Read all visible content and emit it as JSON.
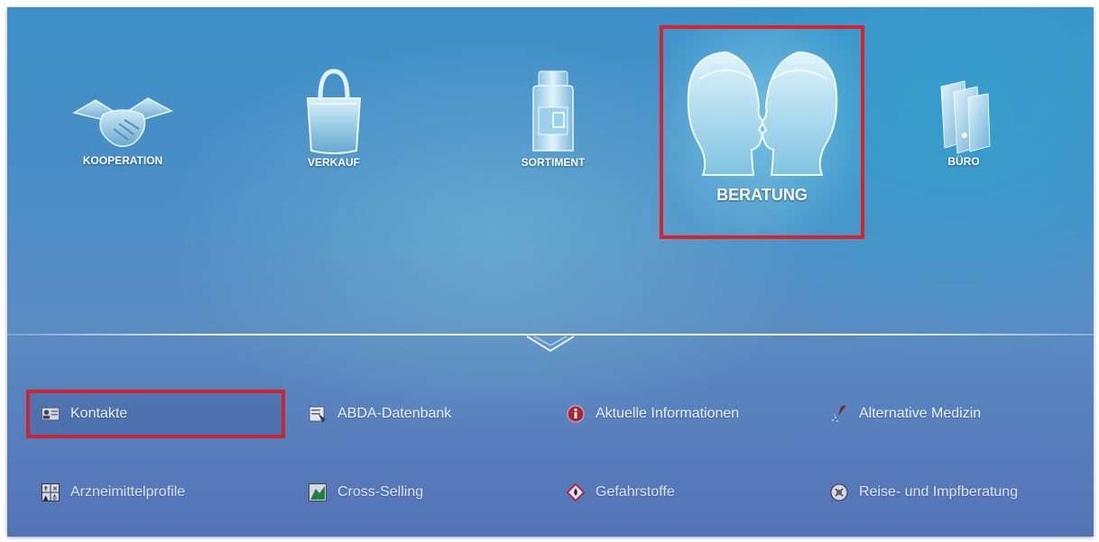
{
  "categories": [
    {
      "key": "kooperation",
      "label": "KOOPERATION"
    },
    {
      "key": "verkauf",
      "label": "VERKAUF"
    },
    {
      "key": "sortiment",
      "label": "SORTIMENT"
    },
    {
      "key": "beratung",
      "label": "BERATUNG"
    },
    {
      "key": "buero",
      "label": "BÜRO"
    }
  ],
  "active_category": "BERATUNG",
  "subitems": [
    {
      "label": "Kontakte",
      "icon": "contact-card-icon"
    },
    {
      "label": "ABDA-Datenbank",
      "icon": "database-icon"
    },
    {
      "label": "Aktuelle Informationen",
      "icon": "info-icon"
    },
    {
      "label": "Alternative Medizin",
      "icon": "mortar-icon"
    },
    {
      "label": "Arzneimittelprofile",
      "icon": "profile-grid-icon"
    },
    {
      "label": "Cross-Selling",
      "icon": "cross-selling-icon"
    },
    {
      "label": "Gefahrstoffe",
      "icon": "hazard-icon"
    },
    {
      "label": "Reise- und Impfberatung",
      "icon": "travel-vaccine-icon"
    }
  ],
  "active_subitem": "Kontakte",
  "colors": {
    "highlight": "#d8232a",
    "text": "#ffffff"
  }
}
